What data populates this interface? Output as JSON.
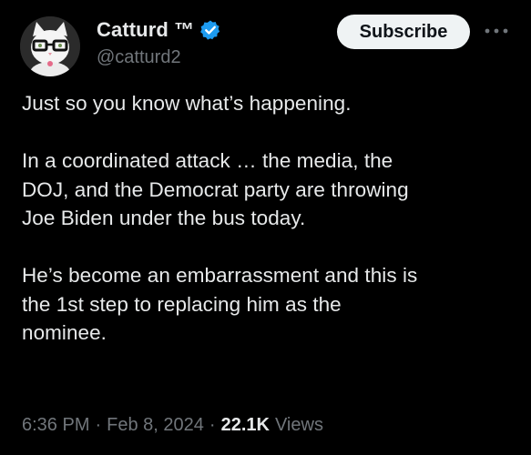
{
  "author": {
    "display_name": "Catturd ™",
    "handle": "@catturd2",
    "verified": true,
    "avatar_icon": "cat-with-glasses-avatar"
  },
  "header": {
    "subscribe_label": "Subscribe",
    "more_icon": "more-options-icon"
  },
  "tweet": {
    "paragraphs": [
      {
        "lines": [
          "Just so you know what’s happening."
        ]
      },
      {
        "lines": [
          "In a coordinated attack … the media, the",
          "DOJ, and the Democrat party are throwing",
          "Joe Biden under the bus today."
        ]
      },
      {
        "lines": [
          "He’s become an embarrassment and this is",
          "the 1st step to replacing him as the",
          "nominee."
        ]
      }
    ]
  },
  "meta": {
    "time": "6:36 PM",
    "separator": "·",
    "date": "Feb 8, 2024",
    "views_count": "22.1K",
    "views_label": "Views"
  },
  "colors": {
    "background": "#000000",
    "primary_text": "#e7e9ea",
    "secondary_text": "#71767b",
    "verified_badge": "#1d9bf0",
    "subscribe_bg": "#eff3f4"
  }
}
